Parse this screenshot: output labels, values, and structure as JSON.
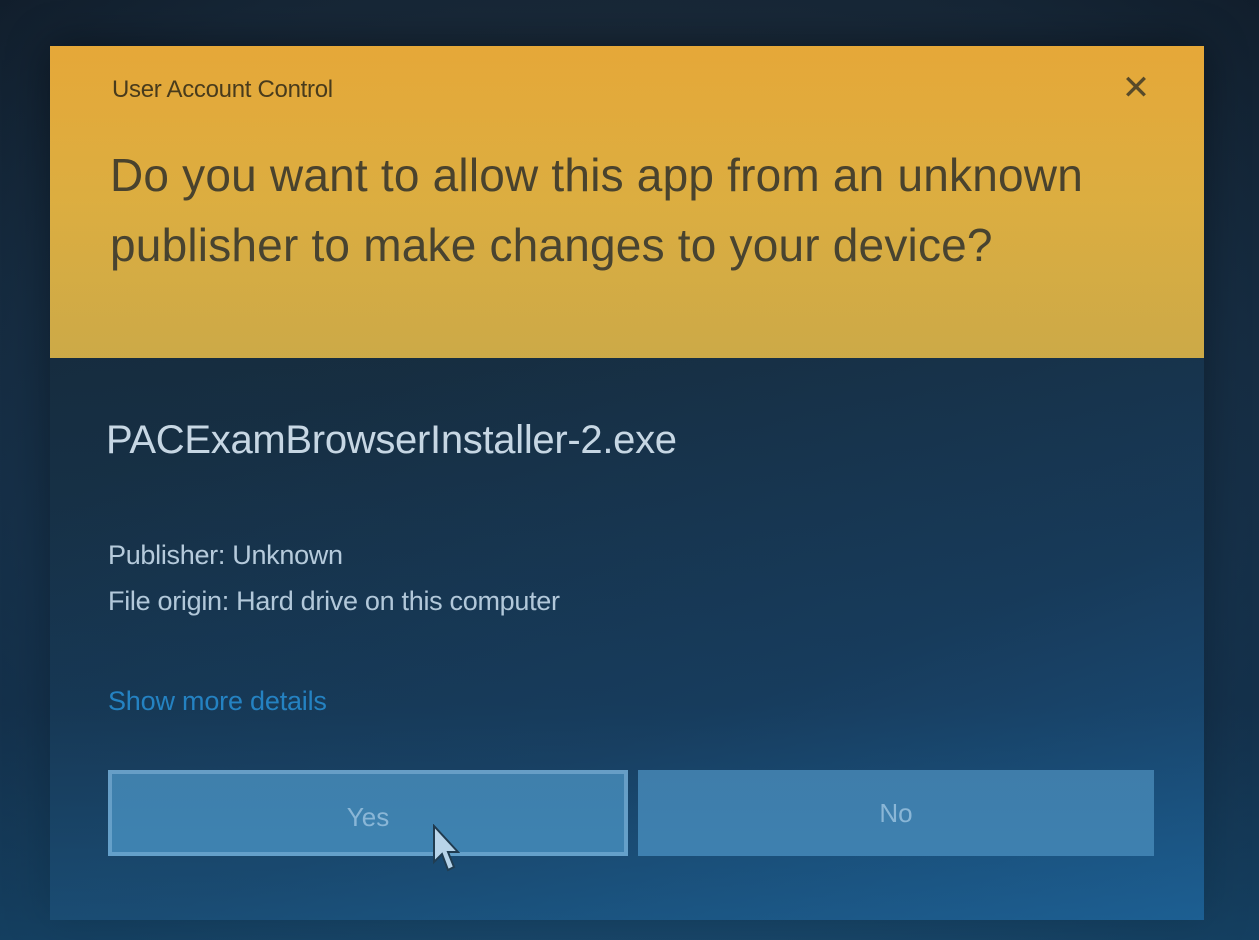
{
  "dialog": {
    "title": "User Account Control",
    "close_glyph": "✕",
    "question": "Do you want to allow this app from an unknown publisher to make changes to your device?",
    "app_name": "PACExamBrowserInstaller-2.exe",
    "publisher": "Publisher: Unknown",
    "file_origin": "File origin: Hard drive on this computer",
    "details_link": "Show more details",
    "yes_label": "Yes",
    "no_label": "No"
  },
  "colors": {
    "header": "#ebb43a",
    "body": "#18324a",
    "link": "#2a8fd0",
    "button": "#4e88ad"
  },
  "icons": {
    "close": "close-icon",
    "cursor": "mouse-pointer-icon"
  }
}
